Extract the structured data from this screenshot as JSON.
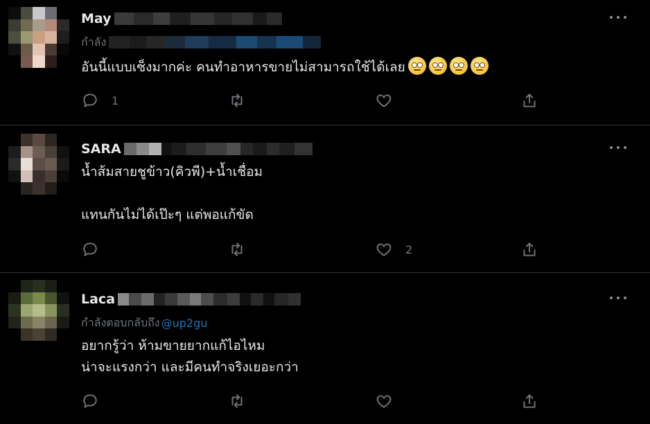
{
  "tweets": [
    {
      "name": "May",
      "reply_prefix": "กำลัง",
      "reply_handle": "",
      "text": "อันนี้แบบเซ็งมากค่ะ คนทำอาหารขายไม่สามารถใช้ได้เลย",
      "emojis": [
        "face-with-rolling-eyes-icon",
        "face-with-rolling-eyes-icon",
        "face-with-rolling-eyes-icon",
        "face-with-rolling-eyes-icon"
      ],
      "reply_count": "1",
      "retweet_count": "",
      "like_count": ""
    },
    {
      "name": "SARA",
      "reply_prefix": "",
      "reply_handle": "",
      "text": "น้ำส้มสายชูข้าว(คิวพี)+น้ำเชื่อม\n\nแทนกันไม่ได้เป๊ะๆ แต่พอแก้ขัด",
      "reply_count": "",
      "retweet_count": "",
      "like_count": "2"
    },
    {
      "name": "Laca",
      "reply_prefix": "กำลังตอบกลับถึง",
      "reply_handle": "@up2gu",
      "text": "อยากรู้ว่า ห้ามขายยากแก้ไอไหม\nน่าจะแรงกว่า และมีคนทำจริงเยอะกว่า",
      "reply_count": "",
      "retweet_count": "",
      "like_count": ""
    }
  ],
  "icons": {
    "reply": "reply-icon",
    "retweet": "retweet-icon",
    "like": "heart-icon",
    "share": "share-icon",
    "more": "more-icon"
  },
  "colors": {
    "background": "#000000",
    "text": "#e7e9ea",
    "muted": "#71767b",
    "link": "#1d9bf0",
    "divider": "#2f3336"
  }
}
